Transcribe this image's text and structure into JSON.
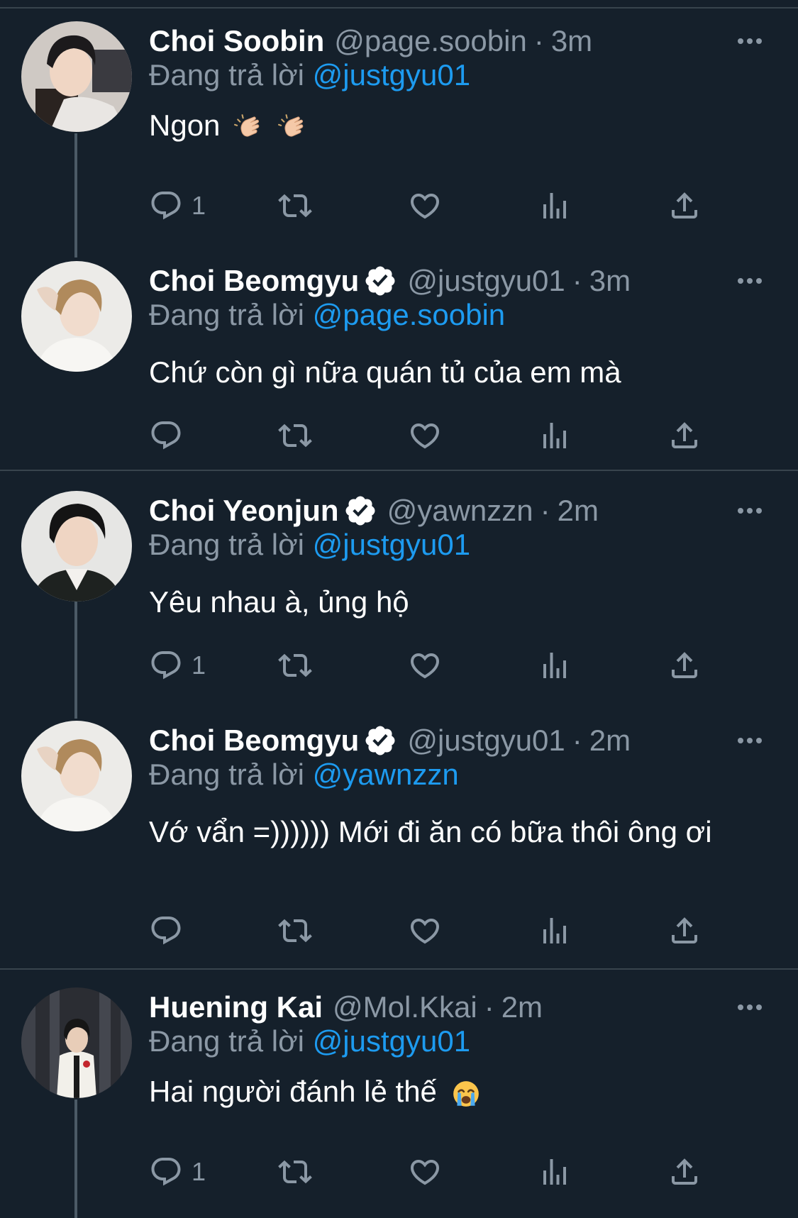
{
  "reply_prefix": "Đang trả lời",
  "tweets": [
    {
      "name": "Choi Soobin",
      "handle": "@page.soobin",
      "dot": "·",
      "time": "3m",
      "reply_to": "@justgyu01",
      "text": "Ngon",
      "reply_count": "1",
      "verified": false
    },
    {
      "name": "Choi Beomgyu",
      "handle": "@justgyu01",
      "dot": "·",
      "time": "3m",
      "reply_to": "@page.soobin",
      "text": "Chứ còn gì nữa quán tủ của em mà",
      "reply_count": "",
      "verified": true
    },
    {
      "name": "Choi Yeonjun",
      "handle": "@yawnzzn",
      "dot": "·",
      "time": "2m",
      "reply_to": "@justgyu01",
      "text": "Yêu nhau à, ủng hộ",
      "reply_count": "1",
      "verified": true
    },
    {
      "name": "Choi Beomgyu",
      "handle": "@justgyu01",
      "dot": "·",
      "time": "2m",
      "reply_to": "@yawnzzn",
      "text": "Vớ vẩn =)))))) Mới đi ăn có bữa thôi ông ơi",
      "reply_count": "",
      "verified": true
    },
    {
      "name": "Huening Kai",
      "handle": "@Mol.Kkai",
      "dot": "·",
      "time": "2m",
      "reply_to": "@justgyu01",
      "text": "Hai người đánh lẻ thế",
      "reply_count": "1",
      "verified": false
    }
  ],
  "icons": {
    "reply": "reply-icon",
    "retweet": "retweet-icon",
    "like": "heart-icon",
    "views": "views-icon",
    "share": "share-icon",
    "more": "more-icon",
    "verified": "verified-badge-icon",
    "emoji_clap": "clapping-hands-icon",
    "emoji_cry": "loudly-crying-face-icon"
  },
  "colors": {
    "background": "#15202b",
    "text": "#ffffff",
    "secondary": "#8b98a5",
    "link": "#1d9bf0",
    "divider": "#38444d"
  }
}
